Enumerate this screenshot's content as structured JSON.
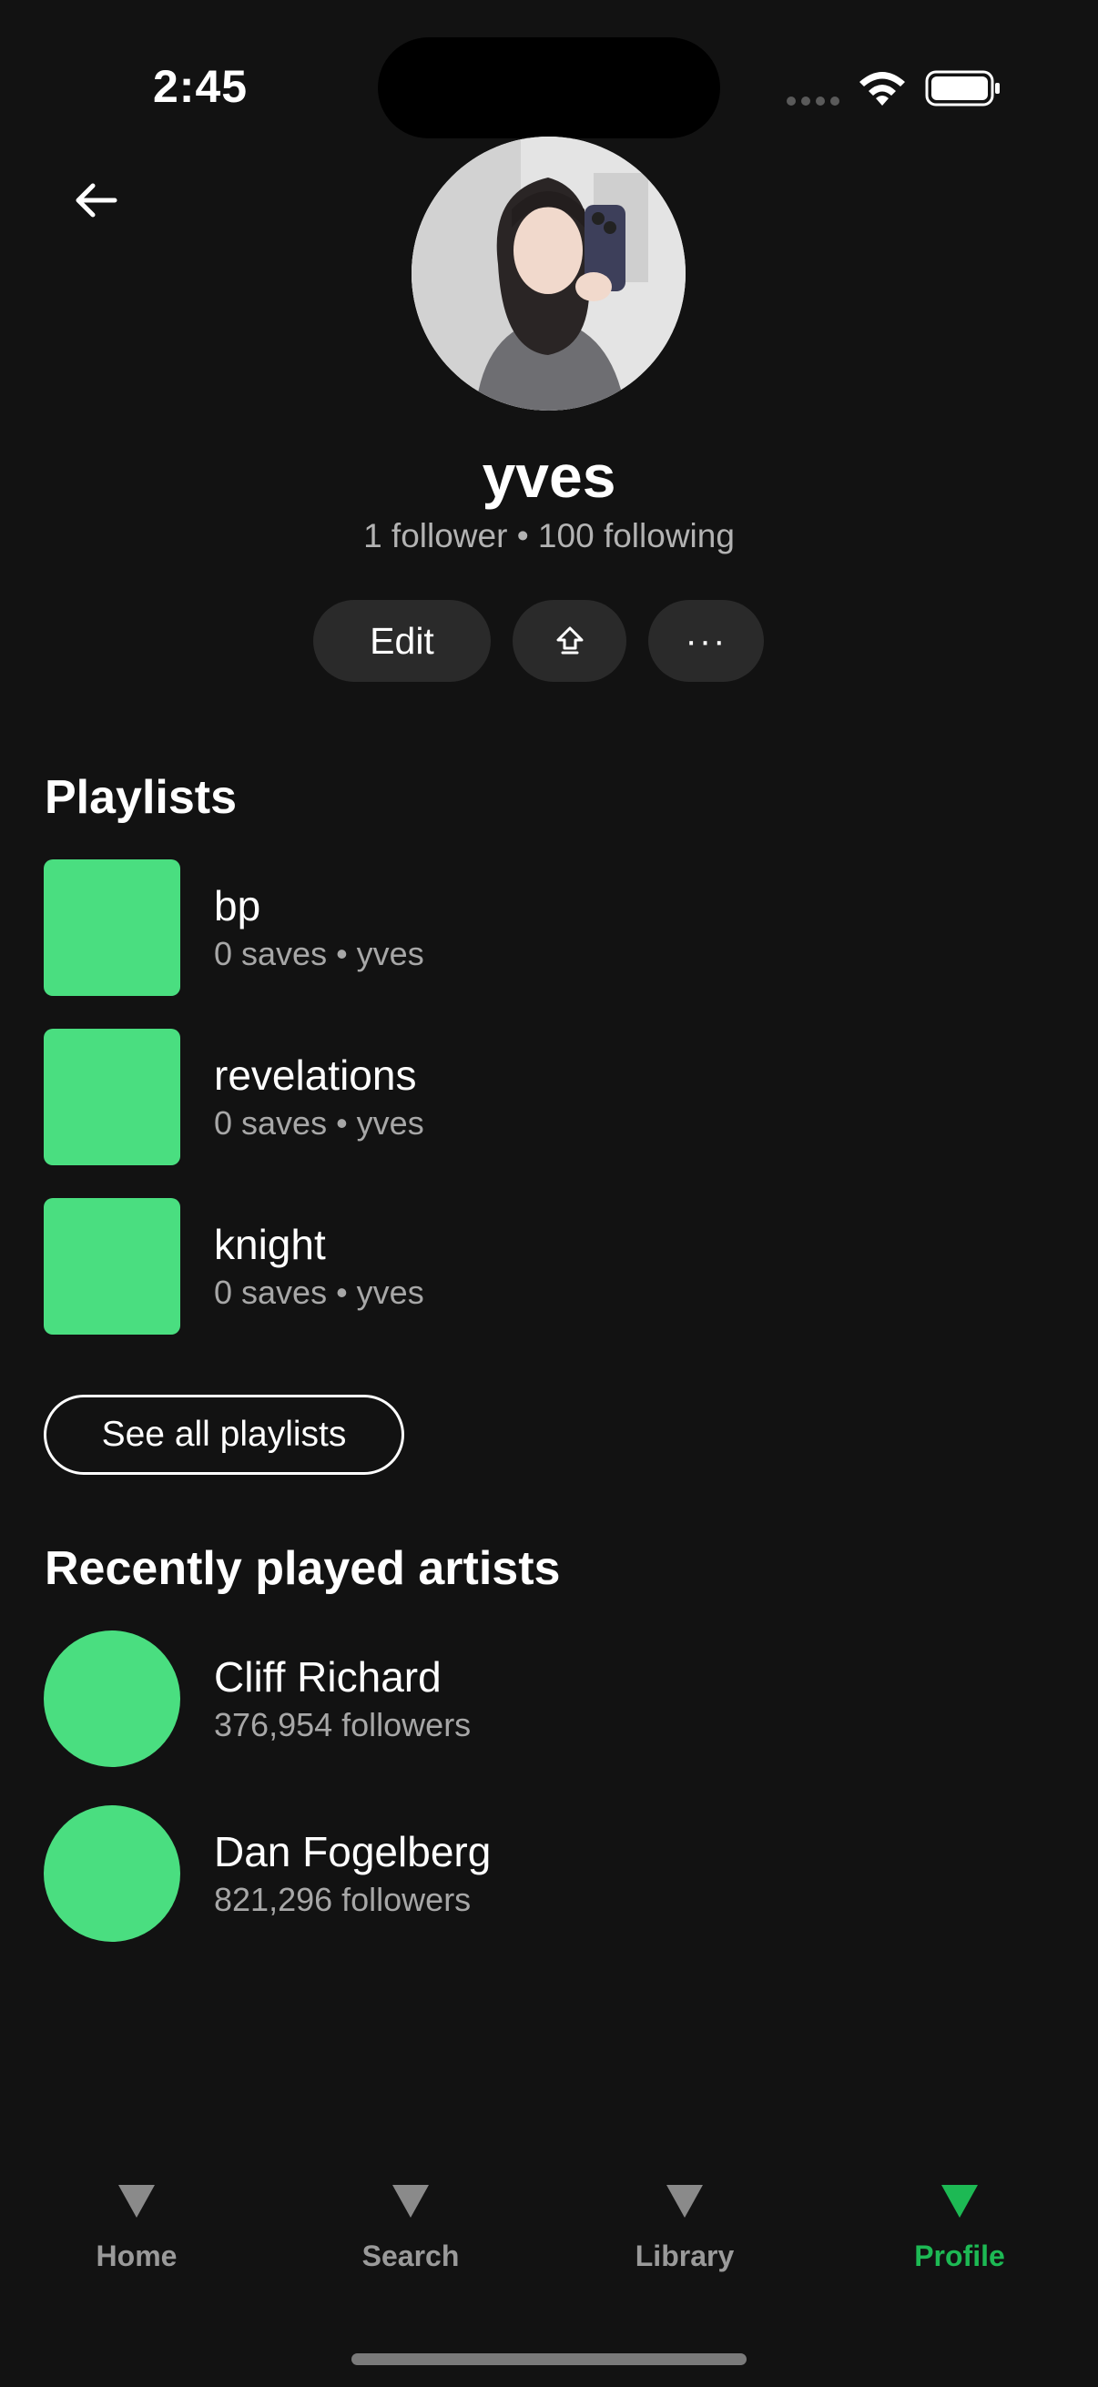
{
  "status_bar": {
    "time": "2:45"
  },
  "profile": {
    "name": "yves",
    "stats": "1 follower • 100 following",
    "edit_label": "Edit",
    "more_label": "···"
  },
  "playlists": {
    "title": "Playlists",
    "items": [
      {
        "name": "bp",
        "meta": "0 saves • yves"
      },
      {
        "name": "revelations",
        "meta": "0 saves • yves"
      },
      {
        "name": "knight",
        "meta": "0 saves • yves"
      }
    ],
    "see_all_label": "See all playlists"
  },
  "artists": {
    "title": "Recently played artists",
    "items": [
      {
        "name": "Cliff Richard",
        "followers": "376,954 followers"
      },
      {
        "name": "Dan Fogelberg",
        "followers": "821,296 followers"
      }
    ]
  },
  "tabs": [
    {
      "label": "Home",
      "icon": "triangle-icon"
    },
    {
      "label": "Search",
      "icon": "triangle-icon"
    },
    {
      "label": "Library",
      "icon": "triangle-icon"
    },
    {
      "label": "Profile",
      "icon": "triangle-icon",
      "active": true
    }
  ],
  "colors": {
    "background": "#121212",
    "accent": "#1db954",
    "thumbnail": "#4ade80"
  }
}
